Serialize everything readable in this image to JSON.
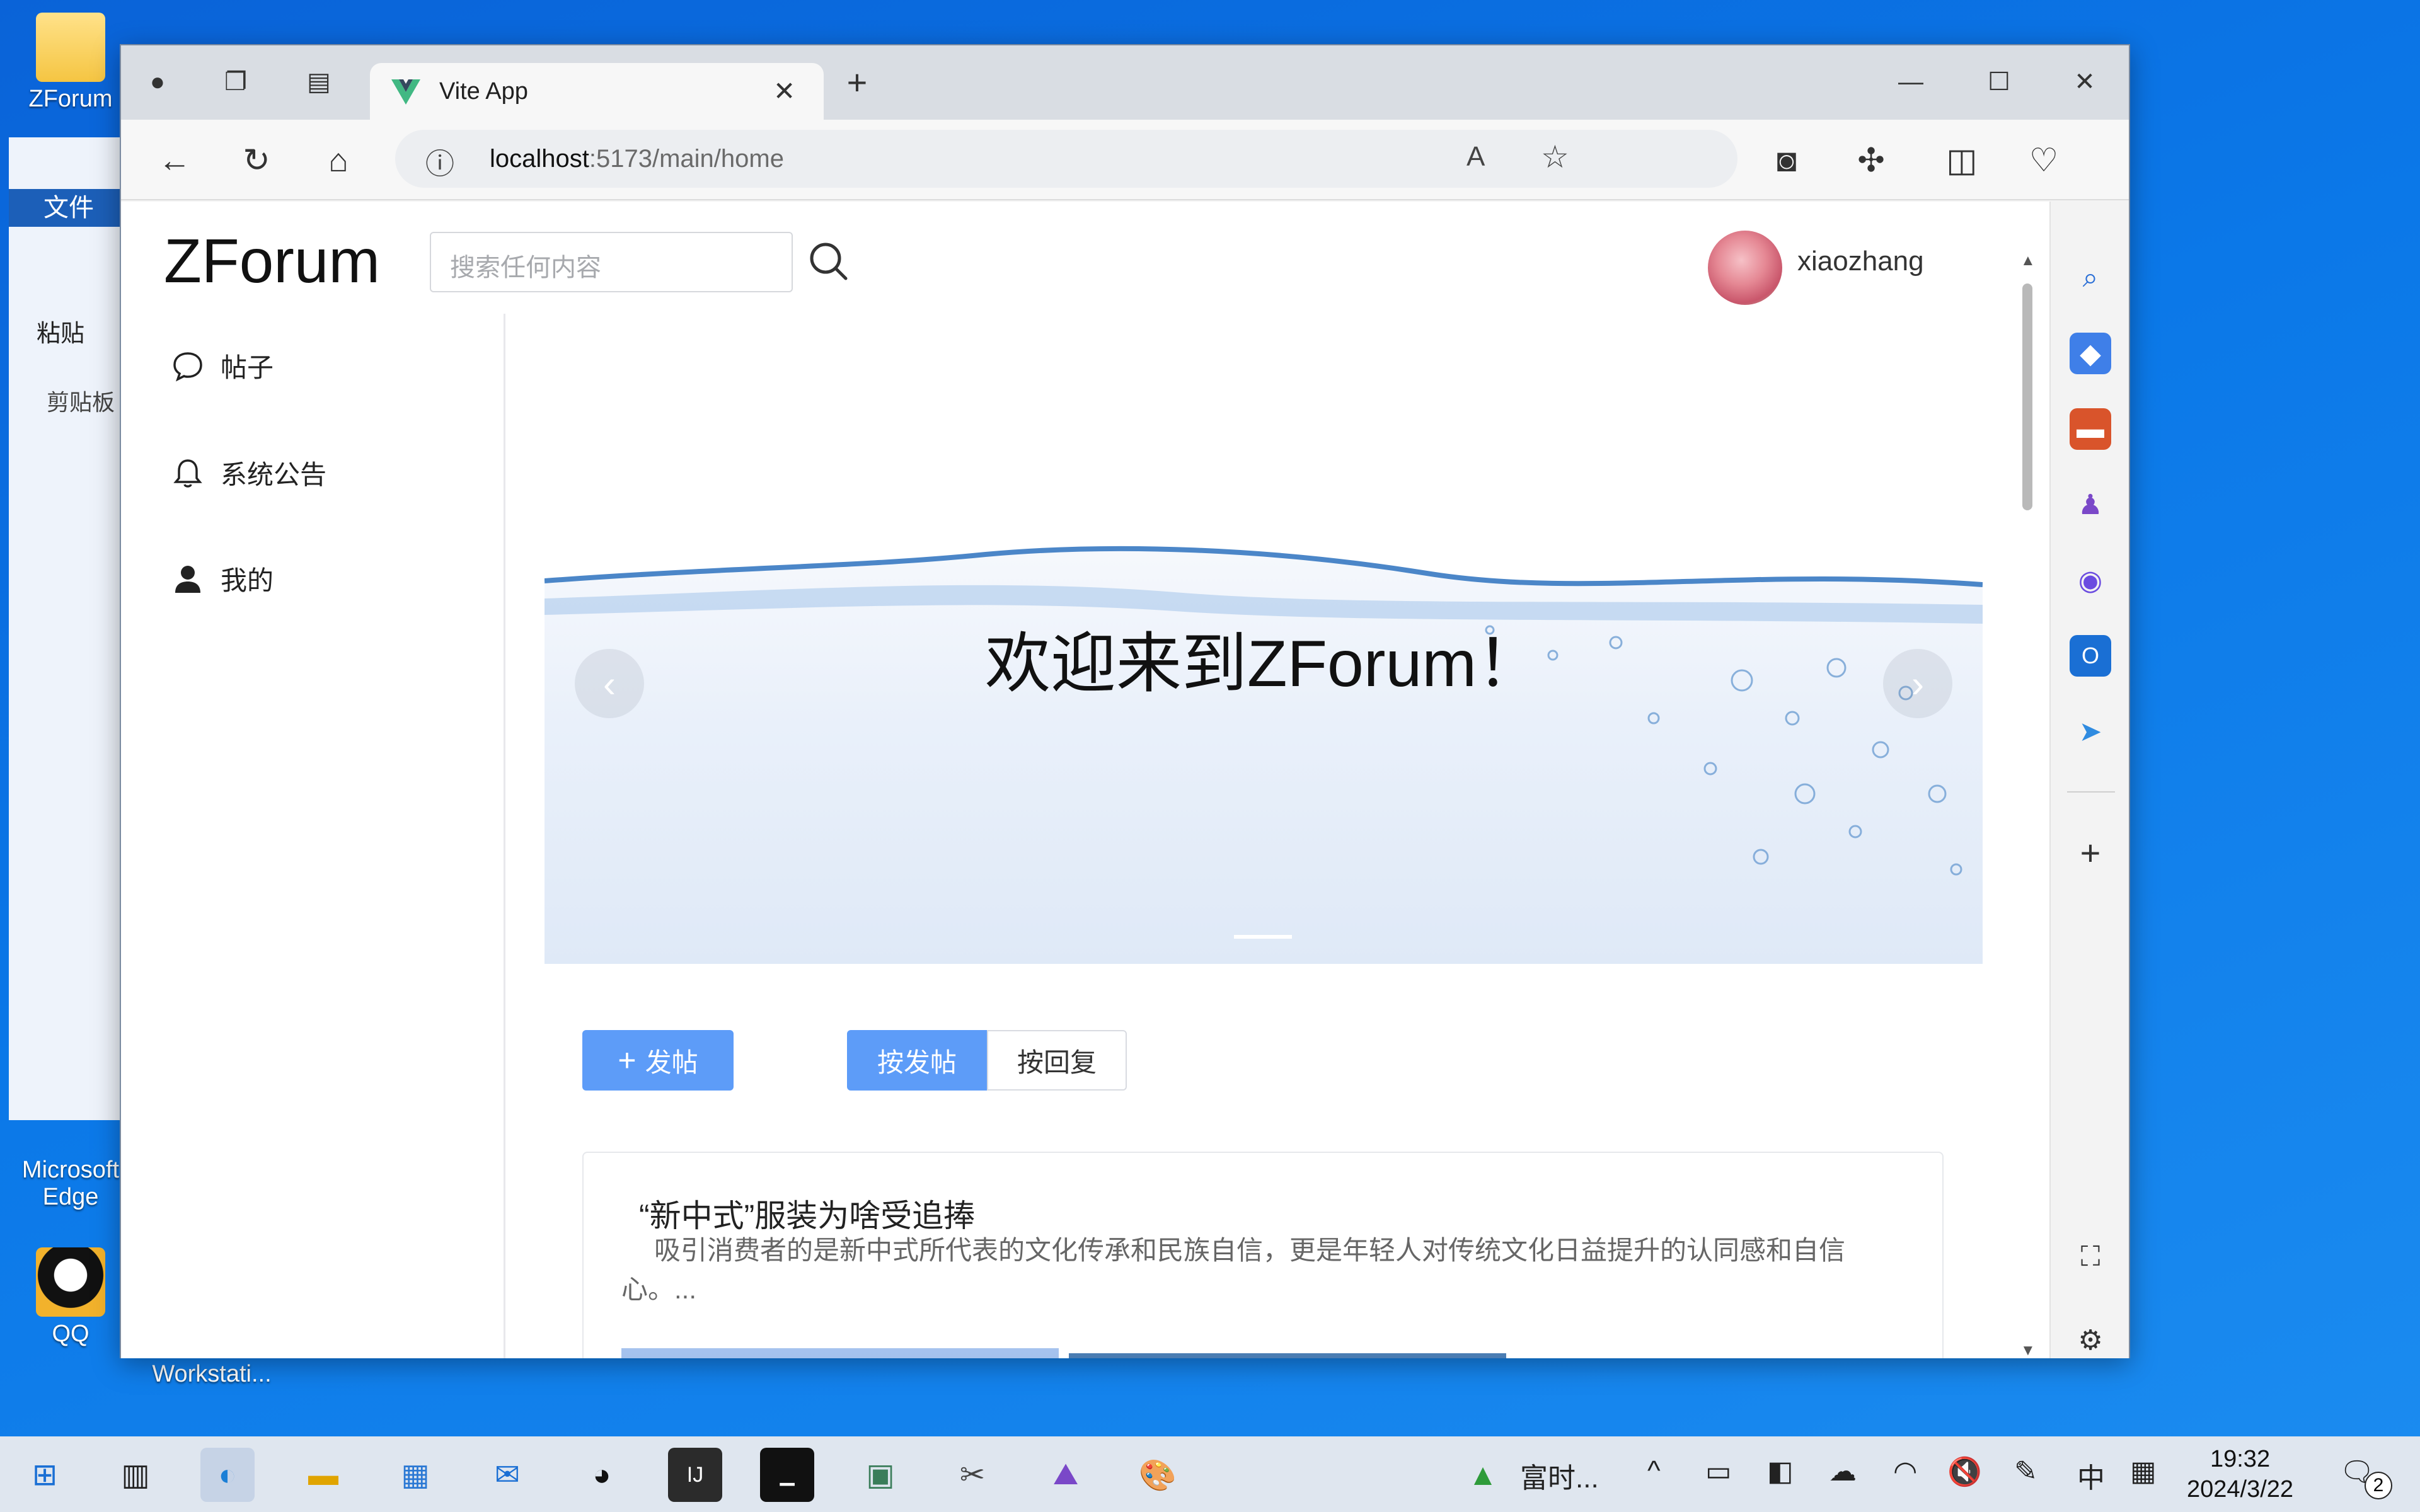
{
  "desktop": {
    "icons": [
      {
        "label": "ZForum"
      },
      {
        "label": "Microsoft Edge"
      },
      {
        "label": "QQ"
      },
      {
        "label": "Workstati..."
      }
    ],
    "paint": {
      "file_tab": "文件",
      "paste": "粘贴",
      "clipboard": "剪贴板"
    }
  },
  "browser": {
    "tab_title": "Vite App",
    "url_host": "localhost",
    "url_path": ":5173/main/home"
  },
  "app": {
    "brand": "ZForum",
    "search_placeholder": "搜索任何内容",
    "username": "xiaozhang",
    "nav": [
      {
        "label": "帖子",
        "icon": "chat-bubble-icon"
      },
      {
        "label": "系统公告",
        "icon": "bell-icon"
      },
      {
        "label": "我的",
        "icon": "user-icon"
      }
    ],
    "carousel": {
      "title": "欢迎来到ZForum！"
    },
    "post_button": "发帖",
    "sort": {
      "by_post": "按发帖",
      "by_reply": "按回复"
    },
    "posts": [
      {
        "title": "“新中式”服装为啥受追捧",
        "excerpt": "吸引消费者的是新中式所代表的文化传承和民族自信，更是年轻人对传统文化日益提升的认同感和自信心。..."
      }
    ]
  },
  "taskbar": {
    "app_label": "富时...",
    "ime": "中",
    "time": "19:32",
    "date": "2024/3/22",
    "notifications": "2"
  }
}
